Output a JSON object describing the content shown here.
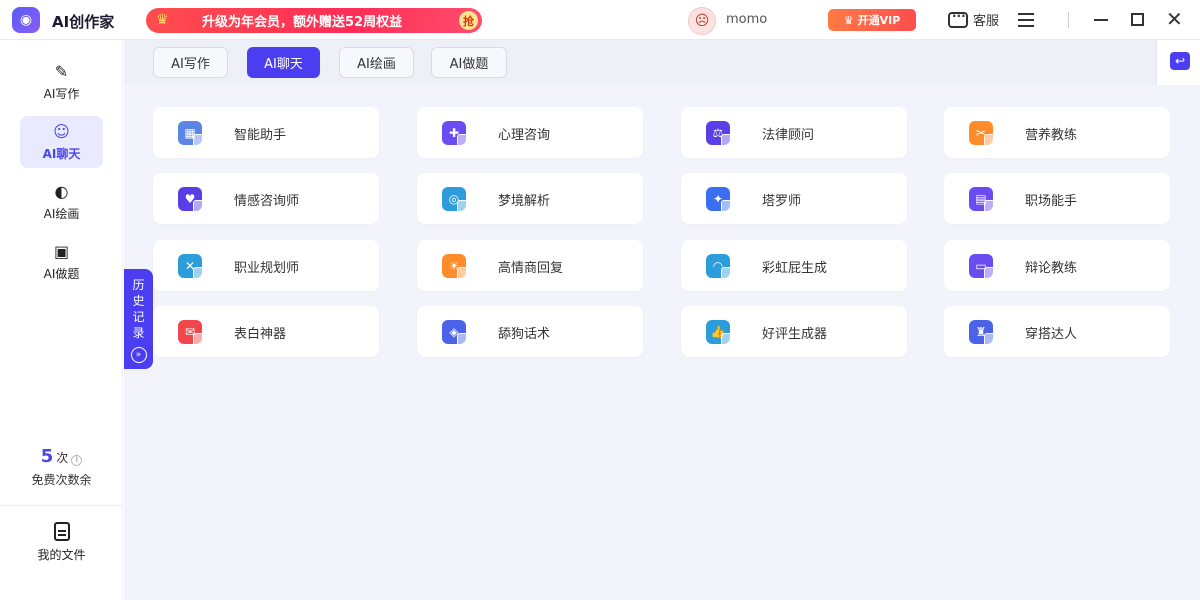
{
  "app": {
    "title": "AI创作家",
    "logo_icon": "game-controller-icon"
  },
  "promo": {
    "text": "升级为年会员，额外赠送52周权益",
    "grab_label": "抢"
  },
  "user": {
    "name": "momo"
  },
  "header": {
    "vip_label": "开通VIP",
    "service_label": "客服"
  },
  "sidebar": {
    "items": [
      {
        "label": "AI写作",
        "icon": "pen-icon",
        "glyph": "✎"
      },
      {
        "label": "AI聊天",
        "icon": "chat-bot-icon",
        "glyph": "☺"
      },
      {
        "label": "AI绘画",
        "icon": "palette-icon",
        "glyph": "◐"
      },
      {
        "label": "AI做题",
        "icon": "bookmark-icon",
        "glyph": "▣"
      }
    ],
    "quota": {
      "count": "5",
      "unit": "次",
      "label": "免费次数余"
    },
    "files_label": "我的文件"
  },
  "tabs": [
    {
      "label": "AI写作",
      "active": false
    },
    {
      "label": "AI聊天",
      "active": true
    },
    {
      "label": "AI绘画",
      "active": false
    },
    {
      "label": "AI做题",
      "active": false
    }
  ],
  "history": {
    "chars": [
      "历",
      "史",
      "记",
      "录"
    ],
    "expand_glyph": "»"
  },
  "cards": [
    {
      "label": "智能助手",
      "icon": "robot-icon",
      "color": "#5b86e5"
    },
    {
      "label": "心理咨询",
      "icon": "heart-consult-icon",
      "color": "#6a4cf0"
    },
    {
      "label": "法律顾问",
      "icon": "scale-icon",
      "color": "#5a3ee6"
    },
    {
      "label": "营养教练",
      "icon": "fork-knife-icon",
      "color": "#ff8c2a"
    },
    {
      "label": "情感咨询师",
      "icon": "emotion-icon",
      "color": "#5a3ee6"
    },
    {
      "label": "梦境解析",
      "icon": "dream-icon",
      "color": "#2d9cdb"
    },
    {
      "label": "塔罗师",
      "icon": "tarot-icon",
      "color": "#3b6ef0"
    },
    {
      "label": "职场能手",
      "icon": "briefcase-icon",
      "color": "#6a4cf0"
    },
    {
      "label": "职业规划师",
      "icon": "tools-icon",
      "color": "#2d9cdb"
    },
    {
      "label": "高情商回复",
      "icon": "sun-reply-icon",
      "color": "#ff8c2a"
    },
    {
      "label": "彩虹屁生成",
      "icon": "rainbow-icon",
      "color": "#2d9cdb"
    },
    {
      "label": "辩论教练",
      "icon": "debate-icon",
      "color": "#6a4cf0"
    },
    {
      "label": "表白神器",
      "icon": "love-letter-icon",
      "color": "#f0474d"
    },
    {
      "label": "舔狗话术",
      "icon": "dog-icon",
      "color": "#4a63e8"
    },
    {
      "label": "好评生成器",
      "icon": "thumbs-up-icon",
      "color": "#2d9cdb"
    },
    {
      "label": "穿搭达人",
      "icon": "outfit-icon",
      "color": "#4a63e8"
    }
  ]
}
